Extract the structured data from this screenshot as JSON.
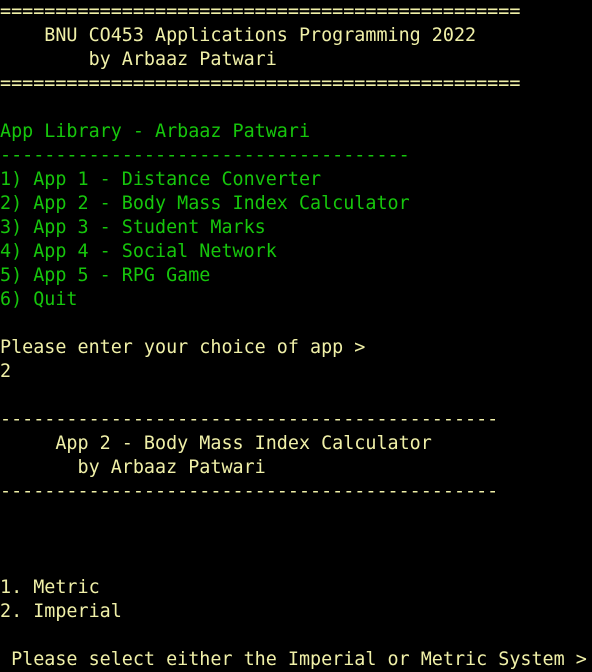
{
  "colors": {
    "background": "#000000",
    "yellow_text": "#f0f0a8",
    "green_text": "#16c60c",
    "white_text": "#f2f2f2"
  },
  "banner": {
    "rule_top": "===============================================",
    "title": "    BNU CO453 Applications Programming 2022",
    "author": "        by Arbaaz Patwari",
    "rule_bottom": "==============================================="
  },
  "library": {
    "heading": "App Library - Arbaaz Patwari",
    "rule": "-------------------------------------",
    "menu_items": [
      "1) App 1 - Distance Converter",
      "2) App 2 - Body Mass Index Calculator",
      "3) App 3 - Student Marks",
      "4) App 4 - Social Network",
      "5) App 5 - RPG Game",
      "6) Quit"
    ],
    "prompt": "Please enter your choice of app >",
    "input_value": "2"
  },
  "app_header": {
    "rule_top": "---------------------------------------------",
    "title": "     App 2 - Body Mass Index Calculator",
    "author": "       by Arbaaz Patwari",
    "rule_bottom": "---------------------------------------------"
  },
  "units_menu": {
    "options": [
      "1. Metric",
      "2. Imperial"
    ],
    "prompt": " Please select either the Imperial or Metric System >"
  }
}
